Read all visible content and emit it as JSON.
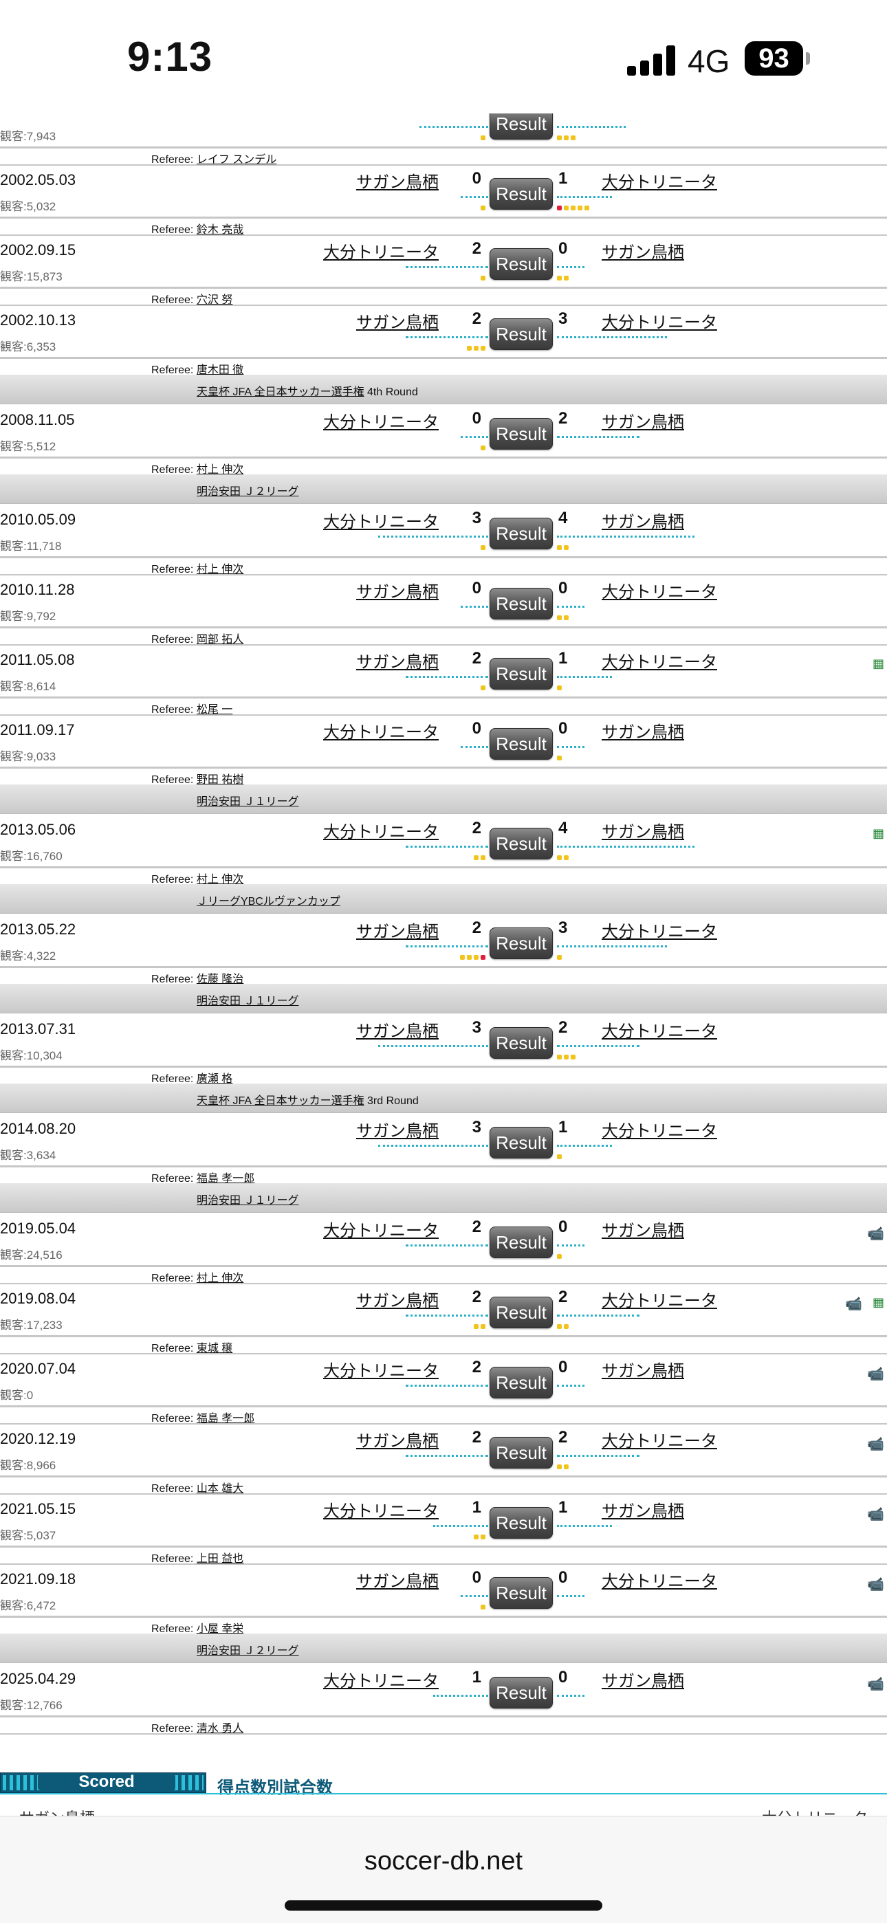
{
  "status_bar": {
    "time": "9:13",
    "network": "4G",
    "battery": "93"
  },
  "referee_prefix": "Referee:",
  "matches": [
    {
      "date": "",
      "att": "観客:7,943",
      "home": "",
      "away": "",
      "hs": "",
      "as": "",
      "ref": "レイフ スンデル",
      "hc": [
        "y"
      ],
      "ac": [
        "y",
        "y",
        "y"
      ],
      "partial": true
    },
    {
      "date": "2002.05.03",
      "att": "観客:5,032",
      "home": "サガン鳥栖",
      "away": "大分トリニータ",
      "hs": "0",
      "as": "1",
      "ref": "鈴木 亮哉",
      "hc": [
        "y"
      ],
      "ac": [
        "r",
        "y",
        "y",
        "y",
        "y"
      ]
    },
    {
      "date": "2002.09.15",
      "att": "観客:15,873",
      "home": "大分トリニータ",
      "away": "サガン鳥栖",
      "hs": "2",
      "as": "0",
      "ref": "穴沢 努",
      "hc": [
        "y"
      ],
      "ac": [
        "y",
        "y"
      ]
    },
    {
      "date": "2002.10.13",
      "att": "観客:6,353",
      "home": "サガン鳥栖",
      "away": "大分トリニータ",
      "hs": "2",
      "as": "3",
      "ref": "唐木田 徹",
      "hc": [
        "y",
        "y",
        "y"
      ],
      "ac": []
    },
    {
      "comp": "天皇杯 JFA 全日本サッカー選手権",
      "suffix": " 4th Round"
    },
    {
      "date": "2008.11.05",
      "att": "観客:5,512",
      "home": "大分トリニータ",
      "away": "サガン鳥栖",
      "hs": "0",
      "as": "2",
      "ref": "村上 伸次",
      "hc": [
        "y"
      ],
      "ac": []
    },
    {
      "comp": "明治安田 Ｊ２リーグ",
      "suffix": ""
    },
    {
      "date": "2010.05.09",
      "att": "観客:11,718",
      "home": "大分トリニータ",
      "away": "サガン鳥栖",
      "hs": "3",
      "as": "4",
      "ref": "村上 伸次",
      "hc": [
        "y"
      ],
      "ac": [
        "y",
        "y"
      ]
    },
    {
      "date": "2010.11.28",
      "att": "観客:9,792",
      "home": "サガン鳥栖",
      "away": "大分トリニータ",
      "hs": "0",
      "as": "0",
      "ref": "岡部 拓人",
      "hc": [],
      "ac": [
        "y",
        "y"
      ]
    },
    {
      "date": "2011.05.08",
      "att": "観客:8,614",
      "home": "サガン鳥栖",
      "away": "大分トリニータ",
      "hs": "2",
      "as": "1",
      "ref": "松尾 一",
      "hc": [
        "y"
      ],
      "ac": [
        "y"
      ],
      "icon": "ball"
    },
    {
      "date": "2011.09.17",
      "att": "観客:9,033",
      "home": "大分トリニータ",
      "away": "サガン鳥栖",
      "hs": "0",
      "as": "0",
      "ref": "野田 祐樹",
      "hc": [],
      "ac": [
        "y"
      ]
    },
    {
      "comp": "明治安田 Ｊ１リーグ",
      "suffix": ""
    },
    {
      "date": "2013.05.06",
      "att": "観客:16,760",
      "home": "大分トリニータ",
      "away": "サガン鳥栖",
      "hs": "2",
      "as": "4",
      "ref": "村上 伸次",
      "hc": [
        "y",
        "y"
      ],
      "ac": [
        "y",
        "y"
      ],
      "icon": "ball"
    },
    {
      "comp": "ＪリーグYBCルヴァンカップ",
      "suffix": ""
    },
    {
      "date": "2013.05.22",
      "att": "観客:4,322",
      "home": "サガン鳥栖",
      "away": "大分トリニータ",
      "hs": "2",
      "as": "3",
      "ref": "佐藤 隆治",
      "hc": [
        "r",
        "y",
        "y",
        "y"
      ],
      "ac": [
        "y"
      ]
    },
    {
      "comp": "明治安田 Ｊ１リーグ",
      "suffix": ""
    },
    {
      "date": "2013.07.31",
      "att": "観客:10,304",
      "home": "サガン鳥栖",
      "away": "大分トリニータ",
      "hs": "3",
      "as": "2",
      "ref": "廣瀬 格",
      "hc": [],
      "ac": [
        "y",
        "y",
        "y"
      ]
    },
    {
      "comp": "天皇杯 JFA 全日本サッカー選手権",
      "suffix": " 3rd Round"
    },
    {
      "date": "2014.08.20",
      "att": "観客:3,634",
      "home": "サガン鳥栖",
      "away": "大分トリニータ",
      "hs": "3",
      "as": "1",
      "ref": "福島 孝一郎",
      "hc": [],
      "ac": [
        "y"
      ]
    },
    {
      "comp": "明治安田 Ｊ１リーグ",
      "suffix": ""
    },
    {
      "date": "2019.05.04",
      "att": "観客:24,516",
      "home": "大分トリニータ",
      "away": "サガン鳥栖",
      "hs": "2",
      "as": "0",
      "ref": "村上 伸次",
      "hc": [],
      "ac": [
        "y"
      ],
      "icon": "video"
    },
    {
      "date": "2019.08.04",
      "att": "観客:17,233",
      "home": "サガン鳥栖",
      "away": "大分トリニータ",
      "hs": "2",
      "as": "2",
      "ref": "東城 穣",
      "hc": [
        "y",
        "y"
      ],
      "ac": [
        "y",
        "y"
      ],
      "icon": "video",
      "icon2": "ball"
    },
    {
      "date": "2020.07.04",
      "att": "観客:0",
      "home": "大分トリニータ",
      "away": "サガン鳥栖",
      "hs": "2",
      "as": "0",
      "ref": "福島 孝一郎",
      "hc": [],
      "ac": [],
      "icon": "video"
    },
    {
      "date": "2020.12.19",
      "att": "観客:8,966",
      "home": "サガン鳥栖",
      "away": "大分トリニータ",
      "hs": "2",
      "as": "2",
      "ref": "山本 雄大",
      "hc": [],
      "ac": [
        "y",
        "y"
      ],
      "icon": "video"
    },
    {
      "date": "2021.05.15",
      "att": "観客:5,037",
      "home": "大分トリニータ",
      "away": "サガン鳥栖",
      "hs": "1",
      "as": "1",
      "ref": "上田 益也",
      "hc": [
        "y",
        "y"
      ],
      "ac": [],
      "icon": "video"
    },
    {
      "date": "2021.09.18",
      "att": "観客:6,472",
      "home": "サガン鳥栖",
      "away": "大分トリニータ",
      "hs": "0",
      "as": "0",
      "ref": "小屋 幸栄",
      "hc": [
        "y"
      ],
      "ac": [],
      "icon": "video"
    },
    {
      "comp": "明治安田 Ｊ２リーグ",
      "suffix": ""
    },
    {
      "date": "2025.04.29",
      "att": "観客:12,766",
      "home": "大分トリニータ",
      "away": "サガン鳥栖",
      "hs": "1",
      "as": "0",
      "ref": "清水 勇人",
      "hc": [],
      "ac": [],
      "icon": "video"
    }
  ],
  "result_label": "Result",
  "scored_section": {
    "label": "Scored",
    "title_jp": "得点数別試合数",
    "team_left": "サガン鳥栖",
    "team_right": "大分トリニータ"
  },
  "browser": {
    "url": "soccer-db.net"
  },
  "colors": {
    "yellow_card": "#f2c319",
    "red_card": "#e0203a",
    "dotted_line": "#2ab0c8",
    "section_accent": "#0d5a78"
  }
}
